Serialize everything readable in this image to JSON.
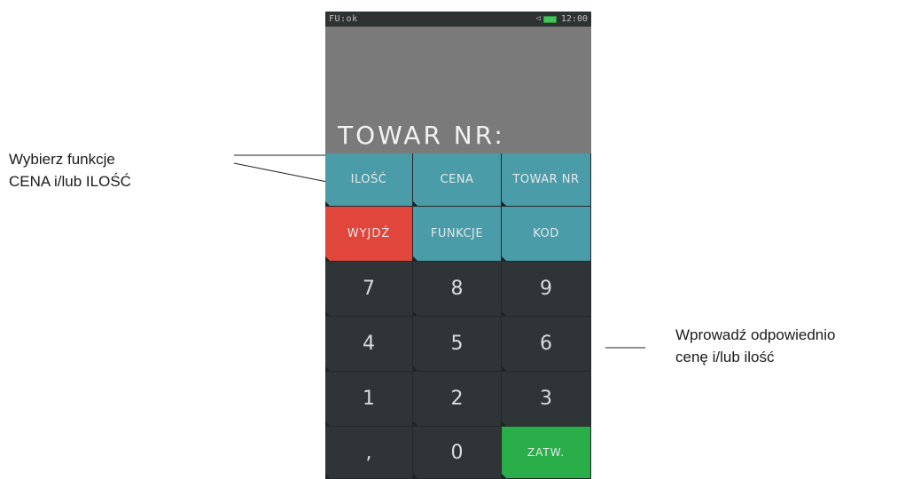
{
  "annotations": {
    "left_line1": "Wybierz funkcje",
    "left_line2": "CENA i/lub ILOŚĆ",
    "right_line1": "Wprowadź odpowiednio",
    "right_line2": "cenę i/lub ilość"
  },
  "statusbar": {
    "left": "FU:ok",
    "time": "12:00",
    "speaker_icon": "speaker-icon",
    "battery_icon": "battery-icon"
  },
  "display": {
    "text": "TOWAR NR:"
  },
  "keys": {
    "ilosc": "ILOŚĆ",
    "cena": "CENA",
    "towar_nr": "TOWAR NR",
    "wyjdz": "WYJDŹ",
    "funkcje": "FUNKCJE",
    "kod": "KOD",
    "k7": "7",
    "k8": "8",
    "k9": "9",
    "k4": "4",
    "k5": "5",
    "k6": "6",
    "k1": "1",
    "k2": "2",
    "k3": "3",
    "comma": ",",
    "k0": "0",
    "zatw": "ZATW."
  },
  "colors": {
    "function_key": "#4a9ca8",
    "exit_key": "#e0463b",
    "number_key": "#2f3536",
    "confirm_key": "#2aae4a",
    "display_bg": "#7a7a7a"
  }
}
